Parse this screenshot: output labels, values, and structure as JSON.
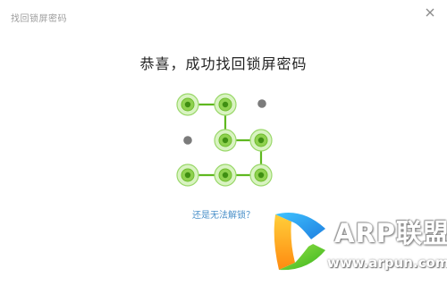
{
  "window": {
    "title": "找回锁屏密码"
  },
  "main": {
    "heading": "恭喜，成功找回锁屏密码",
    "cant_unlock_link": "还是无法解锁？"
  },
  "pattern": {
    "grid": "3x4",
    "path": [
      "r1c1",
      "r1c2",
      "r2c2",
      "r2c3",
      "r3c3",
      "r3c2",
      "r3c1"
    ],
    "unused_dots": [
      "r1c3",
      "r2c1"
    ],
    "colors": {
      "line": "#5fb820",
      "node_fill": "#8fd14f",
      "node_ring": "#cdeeb0",
      "unused_dot": "#7b7b7b"
    }
  },
  "watermark": {
    "title": "ARP联盟",
    "url": "www.arpun.com"
  },
  "colors": {
    "link": "#4a90c9",
    "heading": "#222222",
    "window_title": "#9c9c9c"
  }
}
